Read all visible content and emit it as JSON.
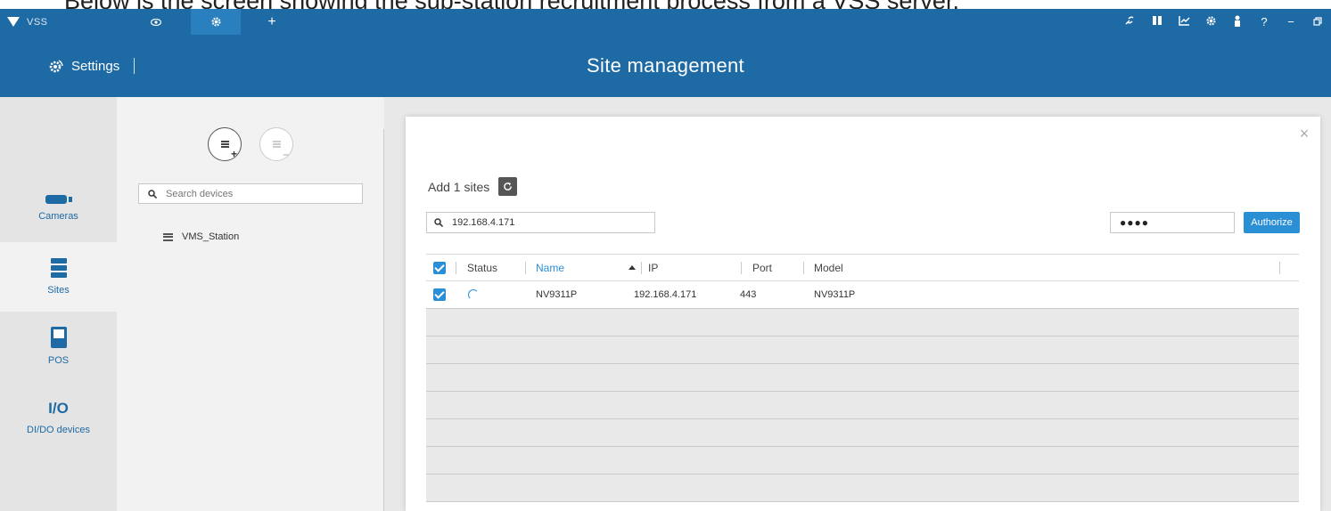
{
  "caption": "Below is the screen showing the sub-station recruitment process from a VSS server.",
  "app": {
    "brand": "VSS"
  },
  "topbar": {
    "tabs": [
      {
        "icon": "eye-icon"
      },
      {
        "icon": "gear-icon",
        "active": true
      },
      {
        "label": "+"
      }
    ],
    "tools": [
      "link-icon",
      "bookmark-icon",
      "chart-icon",
      "gear-icon",
      "user-icon",
      "?",
      "−",
      "restore-icon"
    ]
  },
  "header": {
    "settings_label": "Settings",
    "title": "Site management"
  },
  "leftnav": {
    "items": [
      {
        "label": "Cameras",
        "icon": "camera-icon"
      },
      {
        "label": "Sites",
        "icon": "sites-icon",
        "active": true
      },
      {
        "label": "POS",
        "icon": "pos-icon"
      },
      {
        "label": "DI/DO devices",
        "icon_text": "I/O"
      }
    ]
  },
  "device_panel": {
    "search_placeholder": "Search devices",
    "sites": [
      "VMS_Station"
    ]
  },
  "dialog": {
    "heading": "Add 1 sites",
    "search_value": "192.168.4.171",
    "password_mask": "●●●●",
    "authorize_label": "Authorize",
    "table": {
      "columns": [
        "Status",
        "Name",
        "IP",
        "Port",
        "Model"
      ],
      "sort_column": "Name",
      "rows": [
        {
          "checked": true,
          "status": "loading",
          "name": "NV9311P",
          "ip": "192.168.4.171",
          "port": "443",
          "model": "NV9311P"
        }
      ]
    }
  },
  "colors": {
    "primary": "#1e6aa5",
    "accent": "#2b8fd6"
  }
}
